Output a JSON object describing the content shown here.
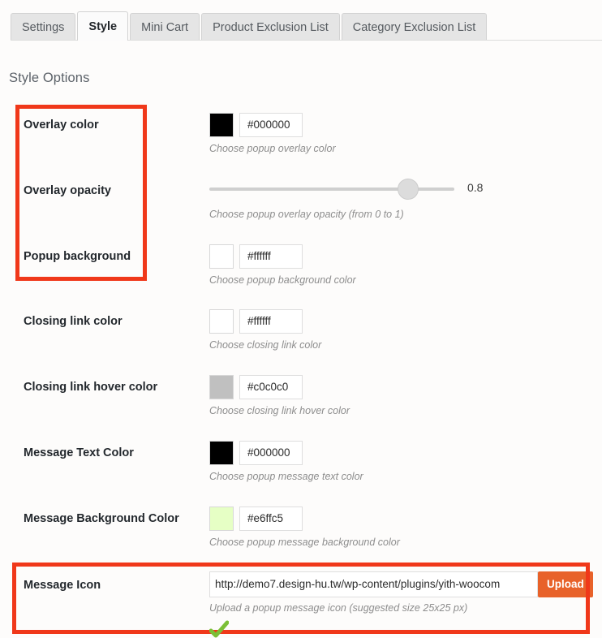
{
  "tabs": [
    {
      "label": "Settings",
      "active": false
    },
    {
      "label": "Style",
      "active": true
    },
    {
      "label": "Mini Cart",
      "active": false
    },
    {
      "label": "Product Exclusion List",
      "active": false
    },
    {
      "label": "Category Exclusion List",
      "active": false
    }
  ],
  "page": {
    "heading": "Style Options"
  },
  "rows": [
    {
      "key": "overlay_color",
      "label": "Overlay color",
      "type": "color",
      "value": "#000000",
      "swatch": "#000000",
      "hint": "Choose popup overlay color"
    },
    {
      "key": "overlay_opacity",
      "label": "Overlay opacity",
      "type": "slider",
      "value": "0.8",
      "min": "0",
      "max": "1",
      "hint": "Choose popup overlay opacity (from 0 to 1)"
    },
    {
      "key": "popup_background",
      "label": "Popup background",
      "type": "color",
      "value": "#ffffff",
      "swatch": "#ffffff",
      "hint": "Choose popup background color"
    },
    {
      "key": "closing_link_color",
      "label": "Closing link color",
      "type": "color",
      "value": "#ffffff",
      "swatch": "#ffffff",
      "hint": "Choose closing link color"
    },
    {
      "key": "closing_link_hover_color",
      "label": "Closing link hover color",
      "type": "color",
      "value": "#c0c0c0",
      "swatch": "#c0c0c0",
      "hint": "Choose closing link hover color"
    },
    {
      "key": "message_text_color",
      "label": "Message Text Color",
      "type": "color",
      "value": "#000000",
      "swatch": "#000000",
      "hint": "Choose popup message text color"
    },
    {
      "key": "message_background_color",
      "label": "Message Background Color",
      "type": "color",
      "value": "#e6ffc5",
      "swatch": "#e6ffc5",
      "hint": "Choose popup message background color"
    },
    {
      "key": "message_icon",
      "label": "Message Icon",
      "type": "upload",
      "value": "http://demo7.design-hu.tw/wp-content/plugins/yith-woocom",
      "button_label": "Upload",
      "hint": "Upload a popup message icon (suggested size 25x25 px)"
    }
  ],
  "annotations": {
    "color": "#f0381a",
    "boxes": [
      {
        "name": "annotation-box-top"
      },
      {
        "name": "annotation-box-bottom"
      }
    ]
  },
  "icons": {
    "check": "check-icon"
  }
}
